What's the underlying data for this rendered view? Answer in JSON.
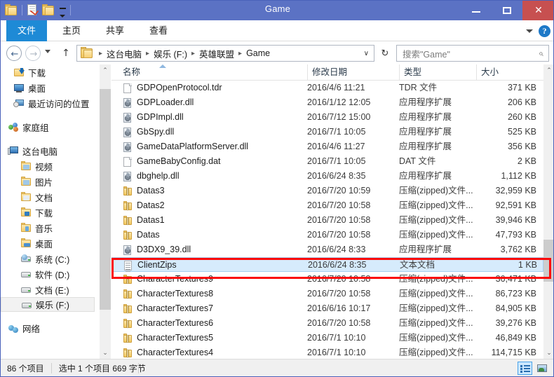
{
  "window": {
    "title": "Game",
    "quick_access": [
      "folder-icon",
      "properties-icon",
      "new-folder-icon",
      "customize-dropdown-icon"
    ],
    "buttons": {
      "minimize": "—",
      "maximize": "❐",
      "close": "✕"
    }
  },
  "ribbon": {
    "tabs": [
      {
        "label": "文件",
        "active": true
      },
      {
        "label": "主页",
        "active": false
      },
      {
        "label": "共享",
        "active": false
      },
      {
        "label": "查看",
        "active": false
      }
    ],
    "collapse_icon": "chevron-down-icon",
    "help_icon": "?"
  },
  "navbar": {
    "back": "←",
    "forward": "→",
    "history_dropdown": "chevron-down-icon",
    "up": "↑",
    "breadcrumbs": [
      "这台电脑",
      "娱乐 (F:)",
      "英雄联盟",
      "Game"
    ],
    "breadcrumb_separator": "▸",
    "address_dropdown": "∨",
    "refresh": "↻",
    "search_placeholder": "搜索\"Game\"",
    "search_value": "",
    "search_icon": "⌕"
  },
  "sidebar": {
    "items": [
      {
        "label": "下载",
        "icon": "download-folder-icon",
        "indent": 1,
        "selected": false
      },
      {
        "label": "桌面",
        "icon": "desktop-icon",
        "indent": 1,
        "selected": false
      },
      {
        "label": "最近访问的位置",
        "icon": "recent-places-icon",
        "indent": 1,
        "selected": false
      },
      {
        "label": "家庭组",
        "icon": "homegroup-icon",
        "indent": 0,
        "selected": false,
        "group_before": true
      },
      {
        "label": "这台电脑",
        "icon": "this-pc-icon",
        "indent": 0,
        "selected": false,
        "group_before": true
      },
      {
        "label": "视频",
        "icon": "folder-video-icon",
        "indent": 2,
        "selected": false
      },
      {
        "label": "图片",
        "icon": "folder-pictures-icon",
        "indent": 2,
        "selected": false
      },
      {
        "label": "文档",
        "icon": "folder-documents-icon",
        "indent": 2,
        "selected": false
      },
      {
        "label": "下载",
        "icon": "folder-downloads-icon",
        "indent": 2,
        "selected": false
      },
      {
        "label": "音乐",
        "icon": "folder-music-icon",
        "indent": 2,
        "selected": false
      },
      {
        "label": "桌面",
        "icon": "folder-desktop-icon",
        "indent": 2,
        "selected": false
      },
      {
        "label": "系统 (C:)",
        "icon": "system-drive-icon",
        "indent": 2,
        "selected": false
      },
      {
        "label": "软件 (D:)",
        "icon": "drive-icon",
        "indent": 2,
        "selected": false
      },
      {
        "label": "文档 (E:)",
        "icon": "drive-icon",
        "indent": 2,
        "selected": false
      },
      {
        "label": "娱乐 (F:)",
        "icon": "drive-icon",
        "indent": 2,
        "selected": true
      },
      {
        "label": "网络",
        "icon": "network-icon",
        "indent": 0,
        "selected": false,
        "group_before": true
      }
    ],
    "scrollbar": {
      "up_arrow": "⌃",
      "down_arrow": "⌄"
    }
  },
  "filelist": {
    "columns": [
      {
        "key": "name",
        "label": "名称",
        "sorted": true,
        "sort_dir": "asc"
      },
      {
        "key": "date",
        "label": "修改日期"
      },
      {
        "key": "type",
        "label": "类型"
      },
      {
        "key": "size",
        "label": "大小"
      }
    ],
    "rows": [
      {
        "name": "GDPOpenProtocol.tdr",
        "date": "2016/4/6 11:21",
        "type": "TDR 文件",
        "size": "371 KB",
        "icon": "generic-file-icon",
        "selected": false
      },
      {
        "name": "GDPLoader.dll",
        "date": "2016/1/12 12:05",
        "type": "应用程序扩展",
        "size": "206 KB",
        "icon": "dll-file-icon",
        "selected": false
      },
      {
        "name": "GDPImpl.dll",
        "date": "2016/7/12 15:00",
        "type": "应用程序扩展",
        "size": "260 KB",
        "icon": "dll-file-icon",
        "selected": false
      },
      {
        "name": "GbSpy.dll",
        "date": "2016/7/1 10:05",
        "type": "应用程序扩展",
        "size": "525 KB",
        "icon": "dll-file-icon",
        "selected": false
      },
      {
        "name": "GameDataPlatformServer.dll",
        "date": "2016/4/6 11:27",
        "type": "应用程序扩展",
        "size": "356 KB",
        "icon": "dll-file-icon",
        "selected": false
      },
      {
        "name": "GameBabyConfig.dat",
        "date": "2016/7/1 10:05",
        "type": "DAT 文件",
        "size": "2 KB",
        "icon": "generic-file-icon",
        "selected": false
      },
      {
        "name": "dbghelp.dll",
        "date": "2016/6/24 8:35",
        "type": "应用程序扩展",
        "size": "1,112 KB",
        "icon": "dll-file-icon",
        "selected": false
      },
      {
        "name": "Datas3",
        "date": "2016/7/20 10:59",
        "type": "压缩(zipped)文件...",
        "size": "32,959 KB",
        "icon": "zip-file-icon",
        "selected": false
      },
      {
        "name": "Datas2",
        "date": "2016/7/20 10:58",
        "type": "压缩(zipped)文件...",
        "size": "92,591 KB",
        "icon": "zip-file-icon",
        "selected": false
      },
      {
        "name": "Datas1",
        "date": "2016/7/20 10:58",
        "type": "压缩(zipped)文件...",
        "size": "39,946 KB",
        "icon": "zip-file-icon",
        "selected": false
      },
      {
        "name": "Datas",
        "date": "2016/7/20 10:58",
        "type": "压缩(zipped)文件...",
        "size": "47,793 KB",
        "icon": "zip-file-icon",
        "selected": false
      },
      {
        "name": "D3DX9_39.dll",
        "date": "2016/6/24 8:33",
        "type": "应用程序扩展",
        "size": "3,762 KB",
        "icon": "dll-file-icon",
        "selected": false
      },
      {
        "name": "ClientZips",
        "date": "2016/6/24 8:35",
        "type": "文本文档",
        "size": "1 KB",
        "icon": "text-file-icon",
        "selected": true
      },
      {
        "name": "CharacterTextures9",
        "date": "2016/7/20 10:58",
        "type": "压缩(zipped)文件...",
        "size": "36,471 KB",
        "icon": "zip-file-icon",
        "selected": false
      },
      {
        "name": "CharacterTextures8",
        "date": "2016/7/20 10:58",
        "type": "压缩(zipped)文件...",
        "size": "86,723 KB",
        "icon": "zip-file-icon",
        "selected": false
      },
      {
        "name": "CharacterTextures7",
        "date": "2016/6/16 10:17",
        "type": "压缩(zipped)文件...",
        "size": "84,905 KB",
        "icon": "zip-file-icon",
        "selected": false
      },
      {
        "name": "CharacterTextures6",
        "date": "2016/7/20 10:58",
        "type": "压缩(zipped)文件...",
        "size": "39,276 KB",
        "icon": "zip-file-icon",
        "selected": false
      },
      {
        "name": "CharacterTextures5",
        "date": "2016/7/1 10:10",
        "type": "压缩(zipped)文件...",
        "size": "46,849 KB",
        "icon": "zip-file-icon",
        "selected": false
      },
      {
        "name": "CharacterTextures4",
        "date": "2016/7/1 10:10",
        "type": "压缩(zipped)文件...",
        "size": "114,715 KB",
        "icon": "zip-file-icon",
        "selected": false
      }
    ],
    "scrollbar": {
      "up_arrow": "⌃",
      "down_arrow": "⌄"
    }
  },
  "statusbar": {
    "item_count": "86 个项目",
    "selection": "选中 1 个项目  669 字节",
    "views": [
      {
        "name": "details-view-button",
        "active": true
      },
      {
        "name": "large-icons-view-button",
        "active": false
      }
    ]
  },
  "annotation": {
    "color": "#fb0b0b",
    "target_row": "ClientZips"
  },
  "colors": {
    "titlebar": "#5b72c4",
    "close_button": "#c75050",
    "file_tab": "#1e8ad6",
    "selection": "#d6ebfc",
    "annotation_red": "#fb0b0b"
  }
}
